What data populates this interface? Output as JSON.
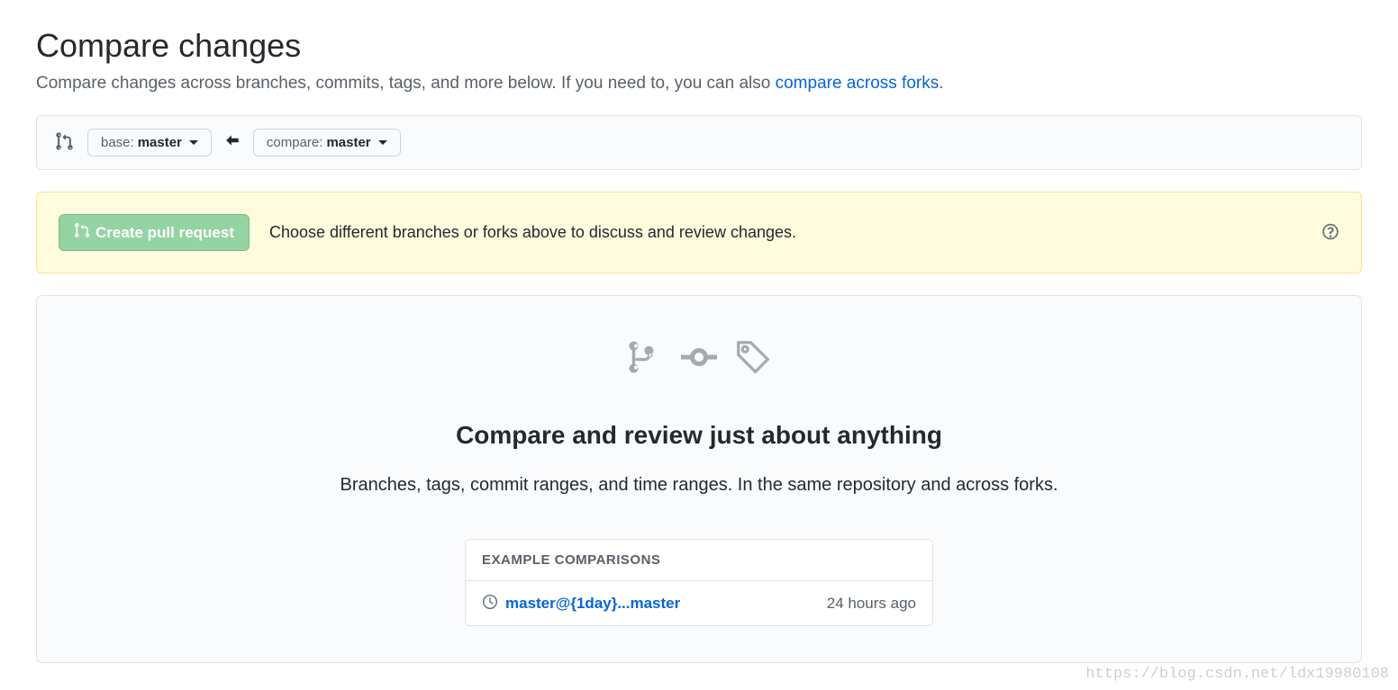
{
  "header": {
    "title": "Compare changes",
    "subtitle_prefix": "Compare changes across branches, commits, tags, and more below. If you need to, you can also ",
    "subtitle_link": "compare across forks",
    "subtitle_suffix": "."
  },
  "range_editor": {
    "base_label": "base: ",
    "base_value": "master",
    "compare_label": "compare: ",
    "compare_value": "master"
  },
  "banner": {
    "create_pr_label": "Create pull request",
    "help_text": "Choose different branches or forks above to discuss and review changes."
  },
  "empty_state": {
    "title": "Compare and review just about anything",
    "desc": "Branches, tags, commit ranges, and time ranges. In the same repository and across forks.",
    "examples_header": "EXAMPLE COMPARISONS",
    "examples": [
      {
        "label": "master@{1day}...master",
        "time": "24 hours ago"
      }
    ]
  },
  "watermark": "https://blog.csdn.net/ldx19980108"
}
